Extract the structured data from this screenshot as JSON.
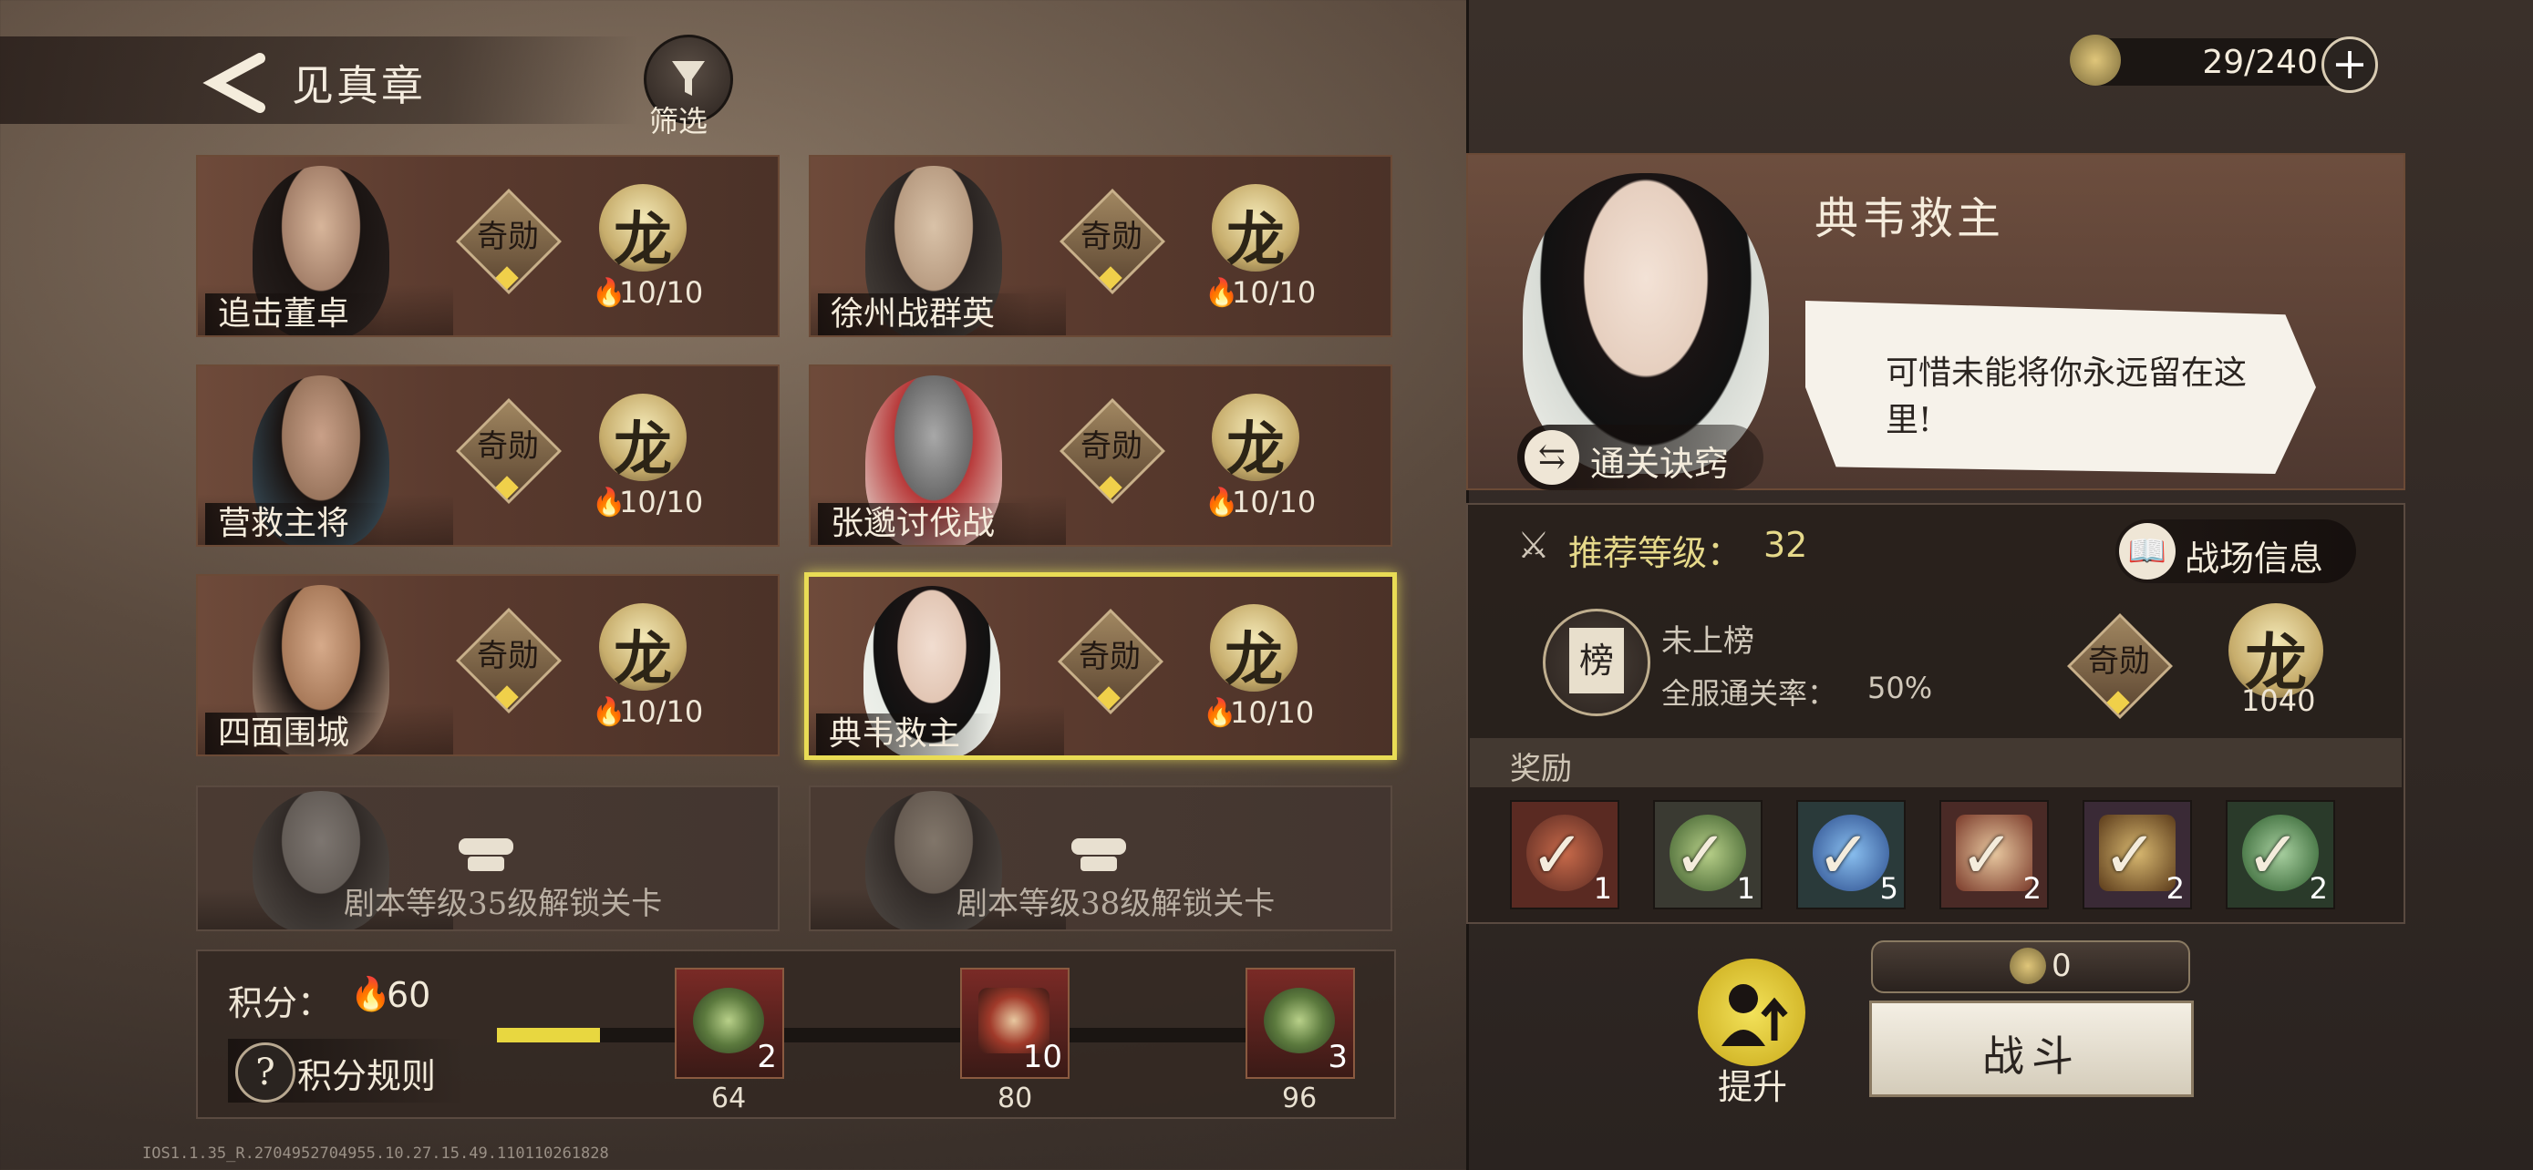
{
  "header": {
    "title": "见真章",
    "filter_label": "筛选"
  },
  "currency": {
    "value": "29/240"
  },
  "stages": [
    {
      "name": "追击董卓",
      "qixun": "奇勋",
      "long": "龙",
      "score": "10/10",
      "locked": false,
      "selected": false
    },
    {
      "name": "徐州战群英",
      "qixun": "奇勋",
      "long": "龙",
      "score": "10/10",
      "locked": false,
      "selected": false
    },
    {
      "name": "营救主将",
      "qixun": "奇勋",
      "long": "龙",
      "score": "10/10",
      "locked": false,
      "selected": false
    },
    {
      "name": "张邈讨伐战",
      "qixun": "奇勋",
      "long": "龙",
      "score": "10/10",
      "locked": false,
      "selected": false
    },
    {
      "name": "四面围城",
      "qixun": "奇勋",
      "long": "龙",
      "score": "10/10",
      "locked": false,
      "selected": false
    },
    {
      "name": "典韦救主",
      "qixun": "奇勋",
      "long": "龙",
      "score": "10/10",
      "locked": false,
      "selected": true
    },
    {
      "lock_text": "剧本等级35级解锁关卡",
      "locked": true
    },
    {
      "lock_text": "剧本等级38级解锁关卡",
      "locked": true
    }
  ],
  "points": {
    "label": "积分：",
    "value": "60",
    "rules_label": "积分规则",
    "progress": 0.12,
    "milestones": [
      {
        "value": "64",
        "count": "2"
      },
      {
        "value": "80",
        "count": "10"
      },
      {
        "value": "96",
        "count": "3"
      }
    ]
  },
  "detail": {
    "title": "典韦救主",
    "quote": "可惜未能将你永远留在这里!",
    "tips_label": "通关诀窍",
    "recommended_label": "推荐等级：",
    "recommended_value": "32",
    "battlefield_label": "战场信息",
    "rank_char": "榜",
    "rank_status": "未上榜",
    "pass_rate_label": "全服通关率：",
    "pass_rate_value": "50%",
    "qixun": "奇勋",
    "long": "龙",
    "long_value": "1040",
    "rewards_label": "奖励",
    "rewards": [
      {
        "count": "1",
        "color": "#8a3a2a"
      },
      {
        "count": "1",
        "color": "#4a6a3a"
      },
      {
        "count": "5",
        "color": "#3a5a9a"
      },
      {
        "count": "2",
        "color": "#7a3a2a"
      },
      {
        "count": "2",
        "color": "#6a4a2a"
      },
      {
        "count": "2",
        "color": "#3a6a3a"
      }
    ]
  },
  "actions": {
    "upgrade_label": "提升",
    "cost_value": "0",
    "fight_label": "战斗"
  },
  "version": "IOS1.1.35_R.2704952704955.10.27.15.49.110110261828"
}
